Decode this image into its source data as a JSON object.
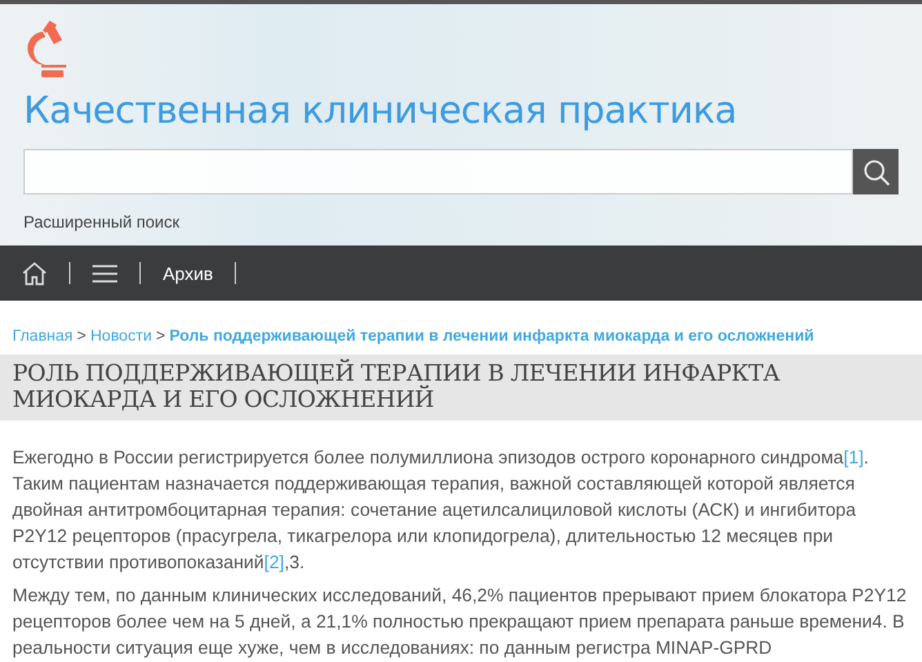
{
  "header": {
    "site_title": "Качественная клиническая практика",
    "advanced_search": "Расширенный поиск"
  },
  "nav": {
    "items": [
      {
        "kind": "home"
      },
      {
        "kind": "menu"
      },
      {
        "kind": "link",
        "label": "Архив"
      }
    ]
  },
  "breadcrumbs": [
    {
      "text": "Главная",
      "current": false
    },
    {
      "separator": ">",
      "text": "Новости",
      "current": false
    },
    {
      "separator": ">",
      "text": "Роль поддерживающей терапии в лечении инфаркта миокарда и его осложнений",
      "current": true
    }
  ],
  "article": {
    "title": "РОЛЬ ПОДДЕРЖИВАЮЩЕЙ ТЕРАПИИ В ЛЕЧЕНИИ ИНФАРКТА МИОКАРДА И ЕГО ОСЛОЖНЕНИЙ",
    "paragraphs": [
      {
        "parts": [
          {
            "kind": "text",
            "text": "Ежегодно в России регистрируется более полумиллиона эпизодов острого коронарного синдрома"
          },
          {
            "kind": "link",
            "text": "[1]"
          },
          {
            "kind": "text",
            "text": ". Таким пациентам назначается поддерживающая терапия, важной составляющей которой является двойная антитромбоцитарная терапия: сочетание ацетилсалициловой кислоты (АСК) и ингибитора P2Y12 рецепторов (прасугрела, тикагрелора или клопидогрела), длительностью 12 месяцев при отсутствии противопоказаний"
          },
          {
            "kind": "link",
            "text": "[2]"
          },
          {
            "kind": "text",
            "text": ",3."
          }
        ]
      },
      {
        "parts": [
          {
            "kind": "text",
            "text": "Между тем, по данным клинических исследований, 46,2% пациентов прерывают прием блокатора P2Y12 рецепторов более чем на 5 дней, а 21,1% полностью прекращают прием препарата раньше времени4. В реальности ситуация еще хуже, чем в исследованиях: по данным регистра MINAP-GPRD"
          }
        ]
      }
    ]
  }
}
